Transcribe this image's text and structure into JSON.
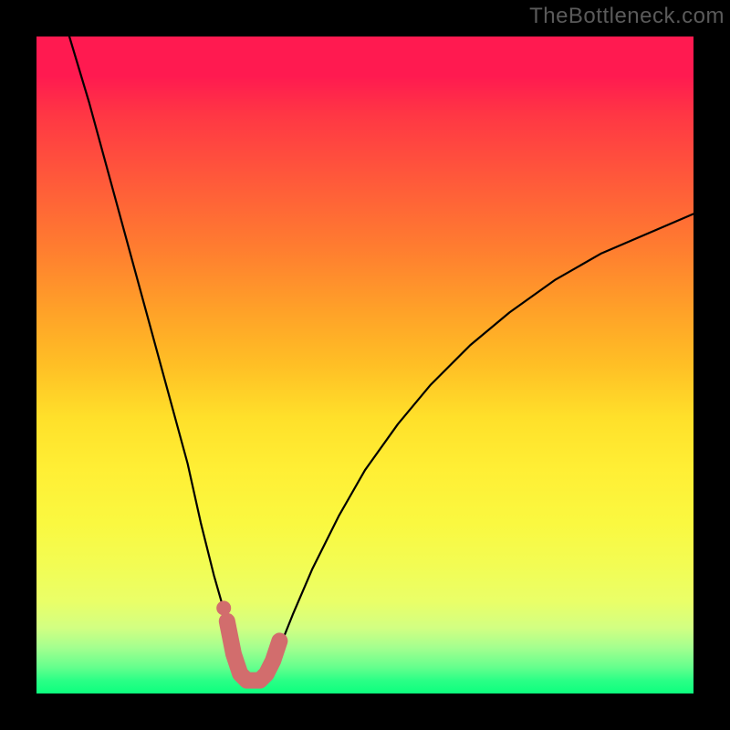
{
  "watermark": "TheBottleneck.com",
  "chart_data": {
    "type": "line",
    "title": "",
    "xlabel": "",
    "ylabel": "",
    "xlim": [
      0,
      100
    ],
    "ylim": [
      0,
      100
    ],
    "grid": false,
    "legend": false,
    "series": [
      {
        "name": "bottleneck-curve",
        "kind": "line",
        "color": "#000000",
        "x": [
          5,
          8,
          11,
          14,
          17,
          20,
          23,
          25,
          27,
          29,
          30.5,
          32,
          33.5,
          35,
          37,
          39,
          42,
          46,
          50,
          55,
          60,
          66,
          72,
          79,
          86,
          93,
          100
        ],
        "y": [
          100,
          90,
          79,
          68,
          57,
          46,
          35,
          26,
          18,
          11,
          6,
          3,
          2,
          3,
          7,
          12,
          19,
          27,
          34,
          41,
          47,
          53,
          58,
          63,
          67,
          70,
          73
        ]
      },
      {
        "name": "optimal-range-highlight",
        "kind": "line",
        "color": "#d26d6d",
        "x": [
          29,
          30,
          31,
          32,
          33,
          34,
          35,
          36,
          37
        ],
        "y": [
          11,
          6,
          3,
          2,
          2,
          2,
          3,
          5,
          8
        ]
      },
      {
        "name": "reference-dot",
        "kind": "scatter",
        "color": "#d26d6d",
        "x": [
          28.5
        ],
        "y": [
          13
        ]
      }
    ],
    "background_gradient": {
      "orientation": "vertical",
      "stops": [
        {
          "pos": 0.0,
          "color": "#ff1a50"
        },
        {
          "pos": 0.5,
          "color": "#ffbf25"
        },
        {
          "pos": 0.8,
          "color": "#f3fc52"
        },
        {
          "pos": 1.0,
          "color": "#0dff7e"
        }
      ]
    }
  }
}
